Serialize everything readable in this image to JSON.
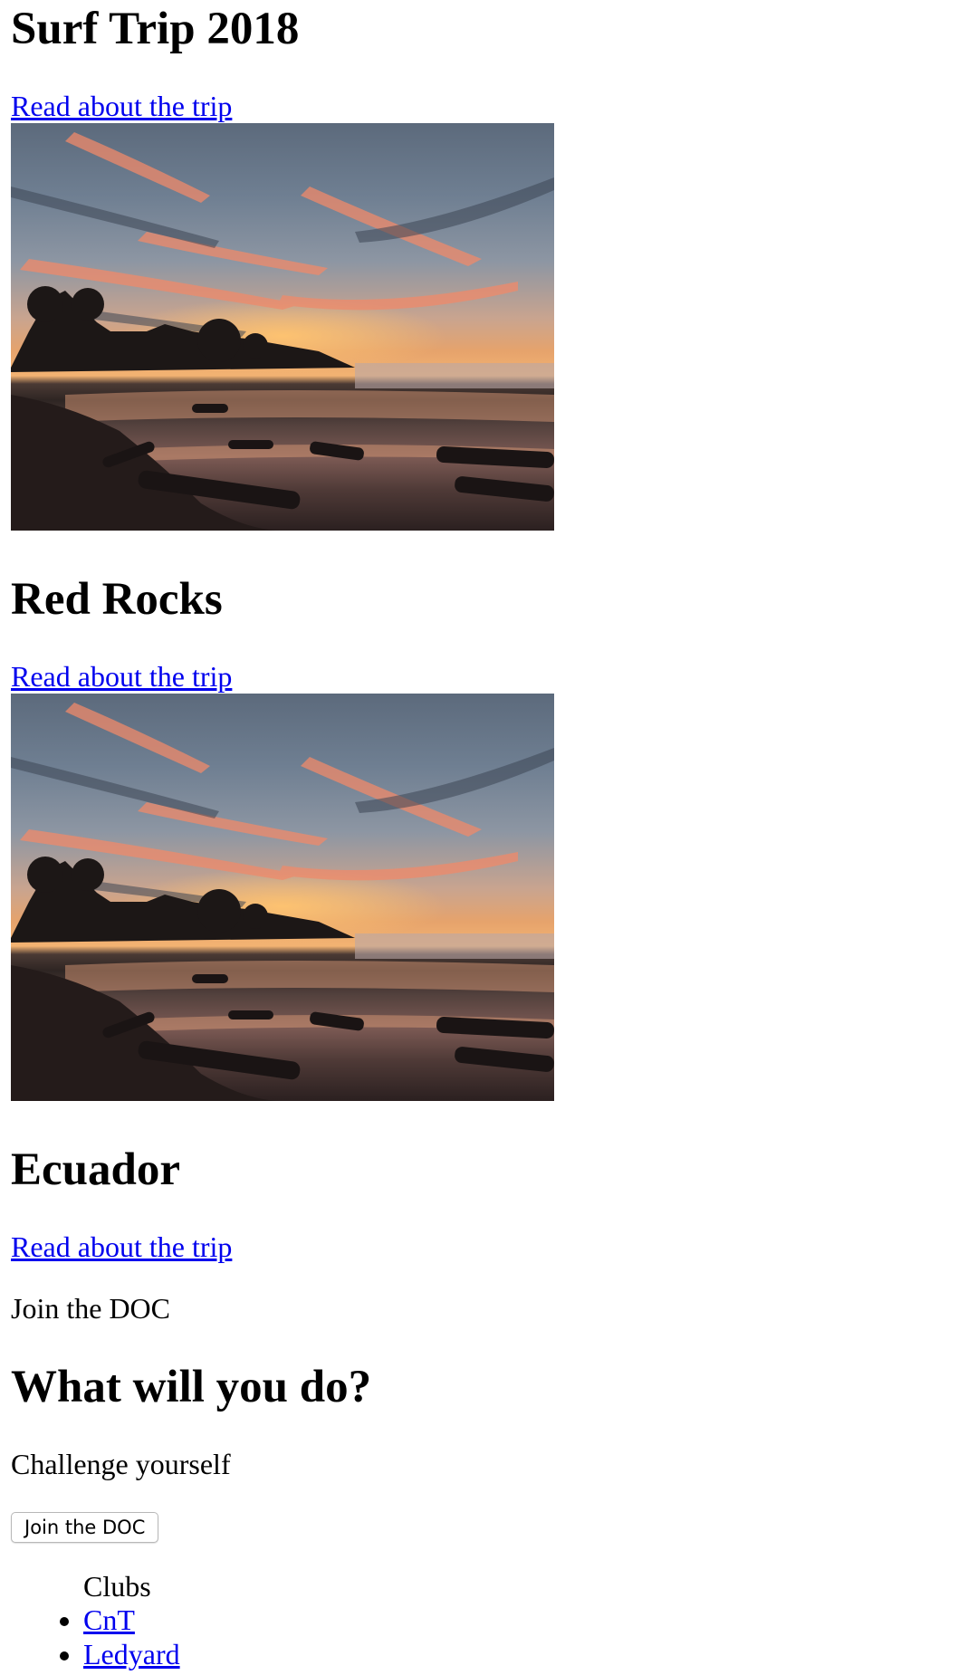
{
  "trips": [
    {
      "title": "Surf Trip 2018",
      "link_label": "Read about the trip",
      "image_alt": "Sunset over a beach"
    },
    {
      "title": "Red Rocks",
      "link_label": "Read about the trip",
      "image_alt": "Sunset over a beach"
    },
    {
      "title": "Ecuador",
      "link_label": "Read about the trip"
    }
  ],
  "join_text": "Join the DOC",
  "what_heading": "What will you do?",
  "challenge_text": "Challenge yourself",
  "join_button_label": "Join the DOC",
  "clubs": {
    "heading": "Clubs",
    "items": [
      "CnT",
      "Ledyard"
    ]
  },
  "colors": {
    "link": "#0000ee",
    "text": "#000000",
    "background": "#ffffff"
  }
}
